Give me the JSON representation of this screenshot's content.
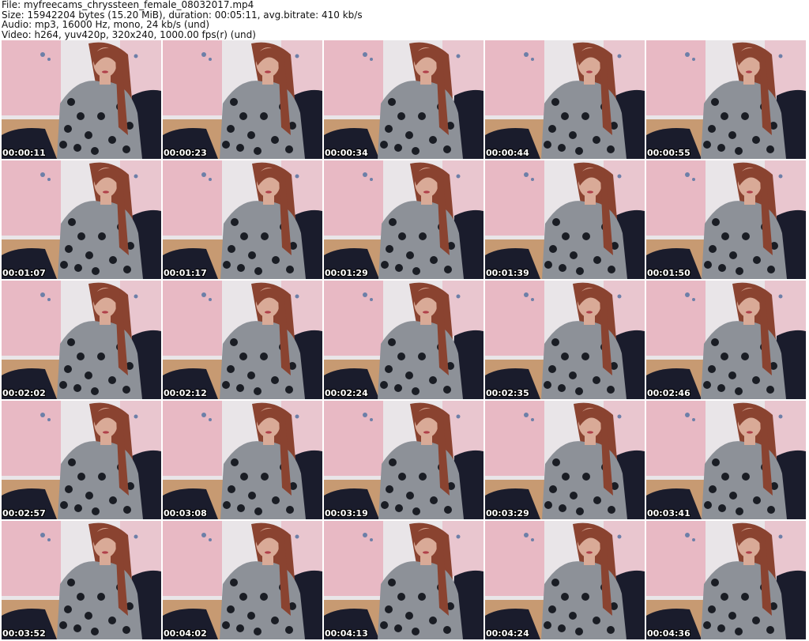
{
  "header": {
    "line1": "File: myfreecams_chryssteen_female_08032017.mp4",
    "line2": "Size: 15942204 bytes (15.20 MiB), duration: 00:05:11, avg.bitrate: 410 kb/s",
    "line3": "Audio: mp3, 16000 Hz, mono, 24 kb/s (und)",
    "line4": "Video: h264, yuv420p, 320x240, 1000.00 fps(r) (und)"
  },
  "thumbnails": [
    "00:00:11",
    "00:00:23",
    "00:00:34",
    "00:00:44",
    "00:00:55",
    "00:01:07",
    "00:01:17",
    "00:01:29",
    "00:01:39",
    "00:01:50",
    "00:02:02",
    "00:02:12",
    "00:02:24",
    "00:02:35",
    "00:02:46",
    "00:02:57",
    "00:03:08",
    "00:03:19",
    "00:03:29",
    "00:03:41",
    "00:03:52",
    "00:04:02",
    "00:04:13",
    "00:04:24",
    "00:04:36"
  ],
  "colors": {
    "wall_pink": "#e8b9c4",
    "wall_light": "#e9e5e8",
    "hair": "#8a4330",
    "skin": "#d9aa97",
    "dress": "#8d9198",
    "dots": "#1a1d24",
    "couch": "#1a1c2c",
    "floor": "#c79a72"
  }
}
